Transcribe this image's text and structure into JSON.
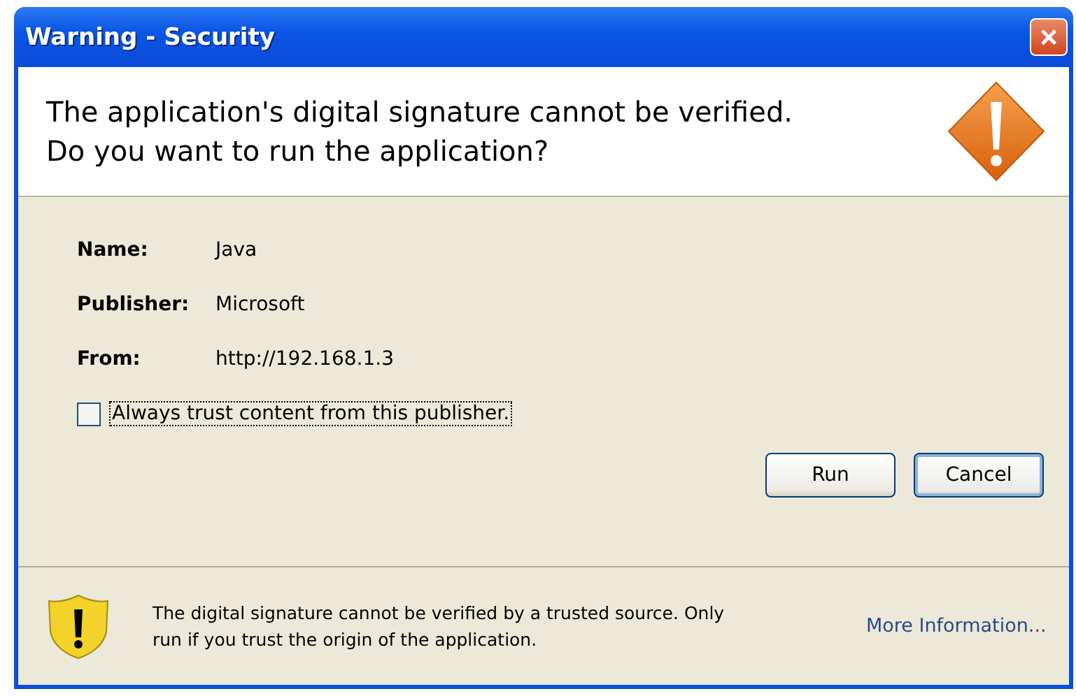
{
  "window": {
    "title": "Warning - Security",
    "close": "×"
  },
  "header": {
    "lines": [
      "The application's digital signature cannot be verified.",
      "Do you want to run the application?"
    ]
  },
  "details": [
    {
      "label": "Name:",
      "value": "Java"
    },
    {
      "label": "Publisher:",
      "value": "Microsoft"
    },
    {
      "label": "From:",
      "value": "http://192.168.1.3"
    }
  ],
  "trust_checkbox": {
    "label": "Always trust content from this publisher.",
    "checked": false
  },
  "buttons": [
    {
      "label": "Run",
      "default": false
    },
    {
      "label": "Cancel",
      "default": true
    }
  ],
  "footer": {
    "lines": [
      "The digital signature cannot be verified by a trusted source.  Only",
      "run if you trust the origin of the application."
    ],
    "link": "More Information..."
  }
}
